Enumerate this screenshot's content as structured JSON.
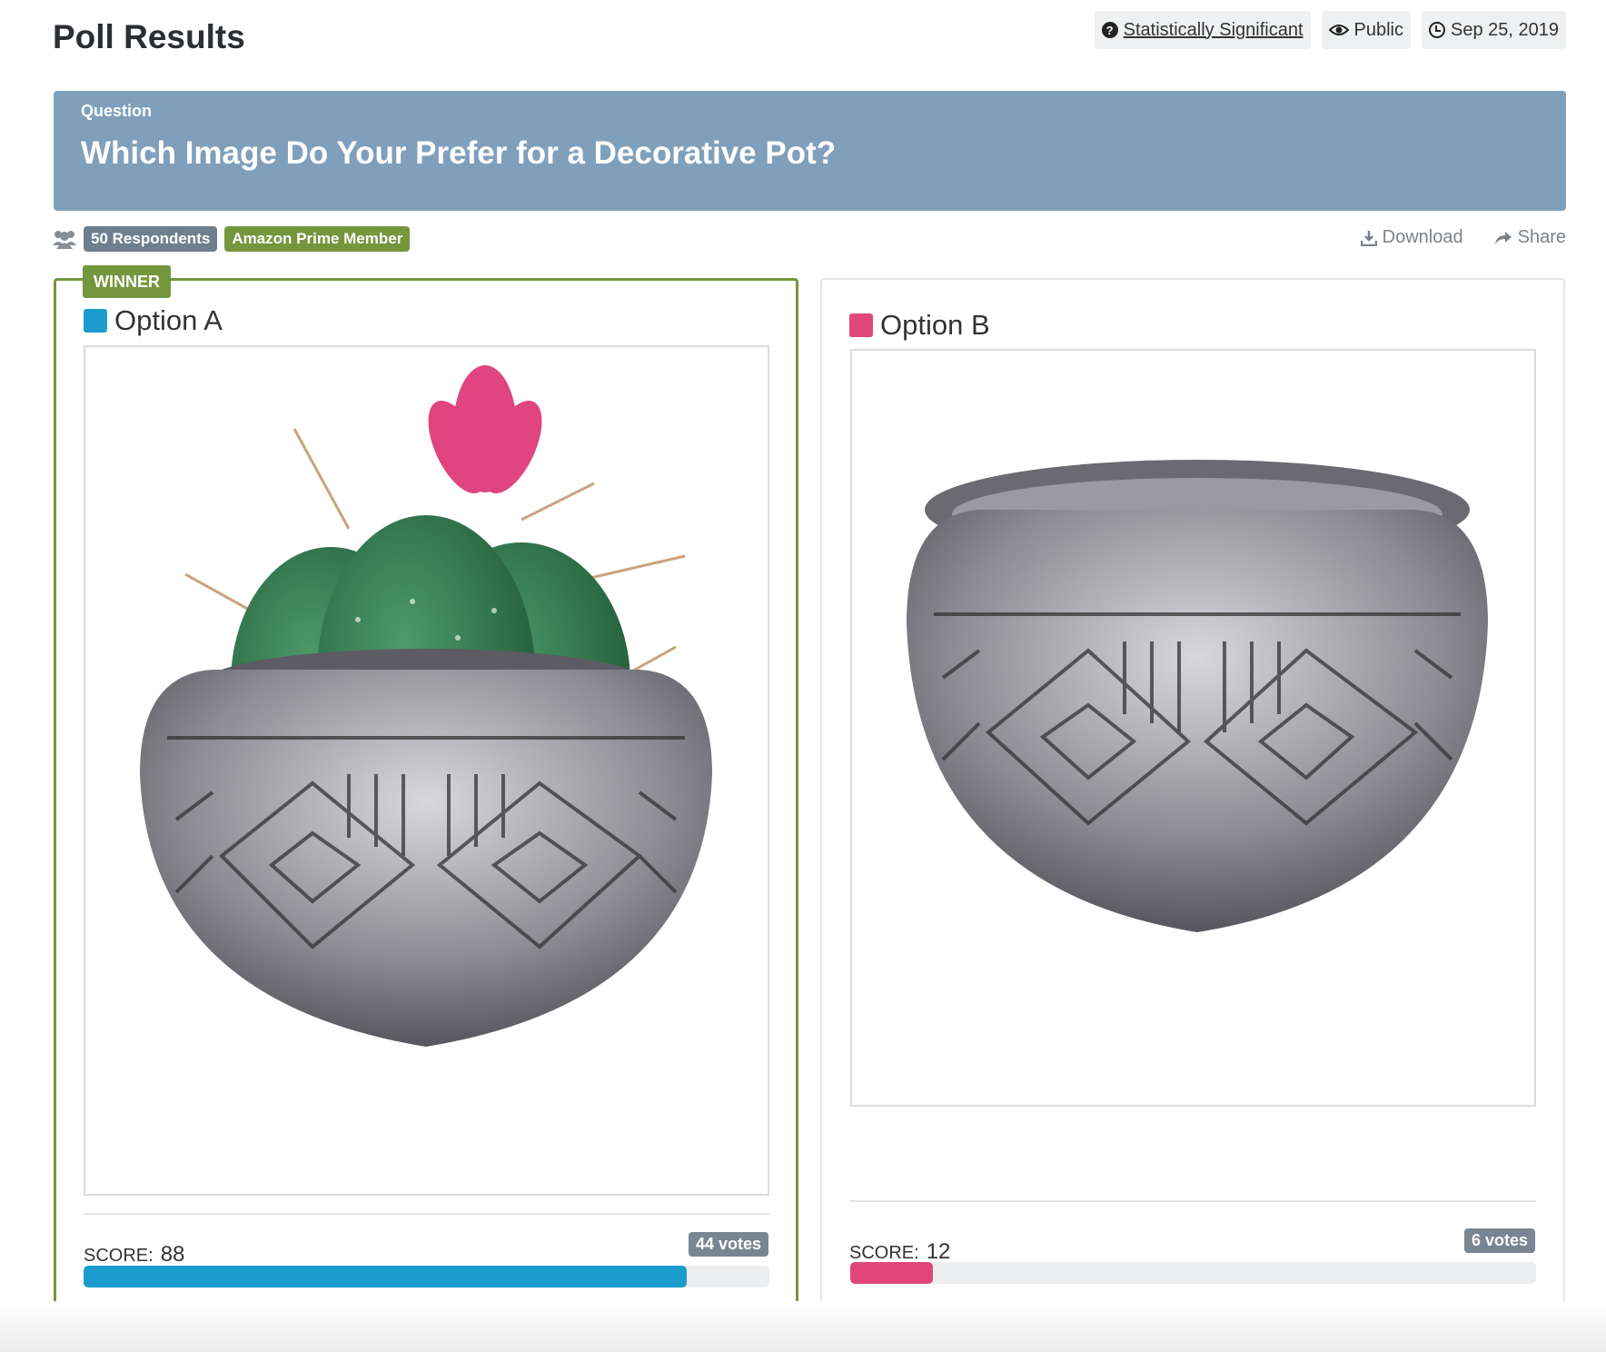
{
  "page": {
    "title": "Poll Results"
  },
  "meta": {
    "significance": {
      "label": "Statistically Significant",
      "icon": "question-circle-icon"
    },
    "visibility": {
      "label": "Public",
      "icon": "eye-icon"
    },
    "date": {
      "label": "Sep 25, 2019",
      "icon": "clock-icon"
    }
  },
  "question": {
    "caption": "Question",
    "text": "Which Image Do Your Prefer for a Decorative Pot?"
  },
  "audience": {
    "respondents": "50 Respondents",
    "segment": "Amazon Prime Member",
    "icon": "users-icon"
  },
  "actions": {
    "download": "Download",
    "share": "Share"
  },
  "options": [
    {
      "label": "Option A",
      "winner_label": "WINNER",
      "color": "#1b9ccc",
      "score_label": "SCORE:",
      "score": "88",
      "votes": "44 votes",
      "fill": 0.88,
      "image": "Cactus with pink flower in engraved silver bowl"
    },
    {
      "label": "Option B",
      "color": "#e0467a",
      "score_label": "SCORE:",
      "score": "12",
      "votes": "6 votes",
      "fill": 0.12,
      "image": "Empty engraved silver bowl"
    }
  ],
  "colors": {
    "banner": "#7f9fbb",
    "winner": "#76963e",
    "badge": "#6f7f8f"
  }
}
